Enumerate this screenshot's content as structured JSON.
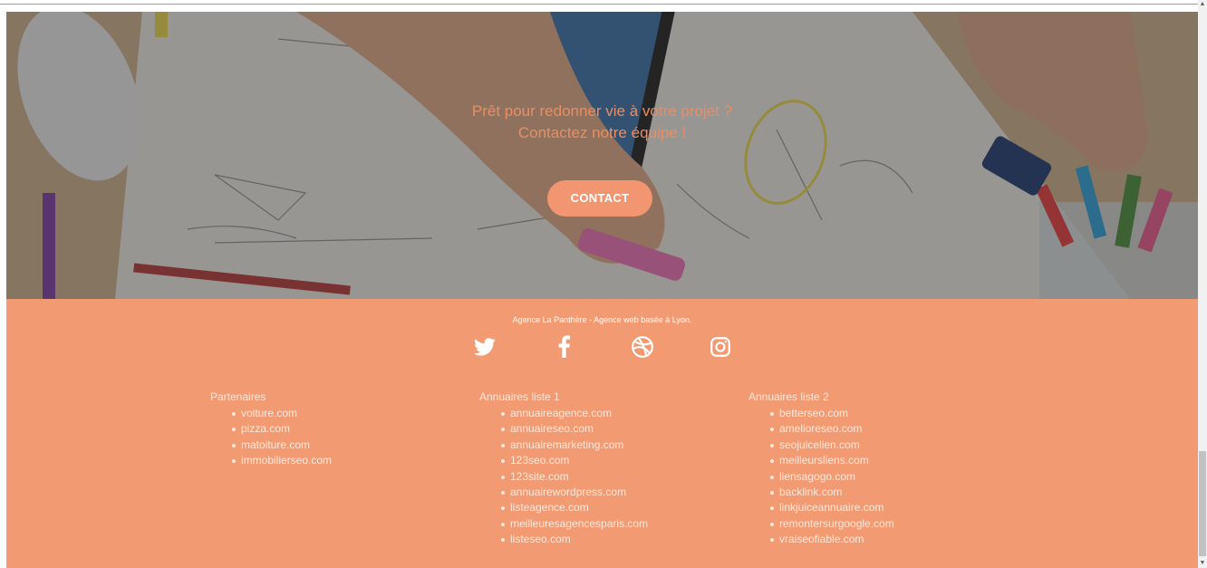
{
  "hero": {
    "line1": "Prêt pour redonner vie à votre projet ?",
    "line2": "Contactez notre équipe !",
    "button_label": "CONTACT"
  },
  "footer": {
    "tagline": "Agence La Panthère - Agence web basée à Lyon.",
    "socials": [
      "twitter-icon",
      "facebook-icon",
      "dribbble-icon",
      "instagram-icon"
    ],
    "columns": [
      {
        "title": "Partenaires",
        "items": [
          "voiture.com",
          "pizza.com",
          "matoiture.com",
          "immobilierseo.com"
        ]
      },
      {
        "title": "Annuaires liste 1",
        "items": [
          "annuaireagence.com",
          "annuaireseo.com",
          "annuairemarketing.com",
          "123seo.com",
          "123site.com",
          "annuairewordpress.com",
          "listeagence.com",
          "meilleuresagencesparis.com",
          "listeseo.com"
        ]
      },
      {
        "title": "Annuaires liste 2",
        "items": [
          "betterseo.com",
          "amelioreseo.com",
          "seojuicelien.com",
          "meilleursliens.com",
          "liensagogo.com",
          "backlink.com",
          "linkjuiceannuaire.com",
          "remontersurgoogle.com",
          "vraiseofiable.com"
        ]
      }
    ]
  },
  "colors": {
    "accent": "#f19670",
    "footer_bg": "#f29a72",
    "hero_text": "#e98e63"
  }
}
